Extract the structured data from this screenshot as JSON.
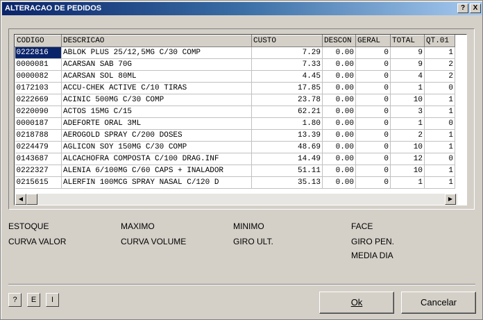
{
  "window": {
    "title": "ALTERACAO DE PEDIDOS",
    "help_label": "?",
    "close_label": "X"
  },
  "grid": {
    "columns": [
      "CODIGO",
      "DESCRICAO",
      "CUSTO",
      "DESCON",
      "GERAL",
      "TOTAL",
      "QT.01"
    ],
    "rows": [
      [
        "0222816",
        "ABLOK PLUS 25/12,5MG C/30 COMP",
        "7.29",
        "0.00",
        "0",
        "9",
        "1"
      ],
      [
        "0000081",
        "ACARSAN SAB 70G",
        "7.33",
        "0.00",
        "0",
        "9",
        "2"
      ],
      [
        "0000082",
        "ACARSAN SOL 80ML",
        "4.45",
        "0.00",
        "0",
        "4",
        "2"
      ],
      [
        "0172103",
        "ACCU-CHEK ACTIVE C/10 TIRAS",
        "17.85",
        "0.00",
        "0",
        "1",
        "0"
      ],
      [
        "0222669",
        "ACINIC 500MG C/30 COMP",
        "23.78",
        "0.00",
        "0",
        "10",
        "1"
      ],
      [
        "0220090",
        "ACTOS 15MG C/15",
        "62.21",
        "0.00",
        "0",
        "3",
        "1"
      ],
      [
        "0000187",
        "ADEFORTE ORAL 3ML",
        "1.80",
        "0.00",
        "0",
        "1",
        "0"
      ],
      [
        "0218788",
        "AEROGOLD SPRAY C/200 DOSES",
        "13.39",
        "0.00",
        "0",
        "2",
        "1"
      ],
      [
        "0224479",
        "AGLICON SOY 150MG C/30 COMP",
        "48.69",
        "0.00",
        "0",
        "10",
        "1"
      ],
      [
        "0143687",
        "ALCACHOFRA COMPOSTA C/100 DRAG.INF",
        "14.49",
        "0.00",
        "0",
        "12",
        "0"
      ],
      [
        "0222327",
        "ALENIA 6/100MG C/60 CAPS + INALADOR",
        "51.11",
        "0.00",
        "0",
        "10",
        "1"
      ],
      [
        "0215615",
        "ALERFIN 100MCG SPRAY NASAL C/120 D",
        "35.13",
        "0.00",
        "0",
        "1",
        "1"
      ]
    ]
  },
  "stats": {
    "estoque": "ESTOQUE",
    "maximo": "MAXIMO",
    "minimo": "MINIMO",
    "face": "FACE",
    "curva_valor": "CURVA VALOR",
    "curva_volume": "CURVA VOLUME",
    "giro_ult": "GIRO ULT.",
    "giro_pen": "GIRO PEN.",
    "media_dia": "MEDIA DIA"
  },
  "buttons": {
    "help": "?",
    "e": "E",
    "i": "I",
    "ok": "Ok",
    "cancel": "Cancelar"
  },
  "scroll_icons": [
    "arrow-up-icon",
    "arrow-down-icon",
    "arrow-left-icon",
    "arrow-right-icon"
  ]
}
